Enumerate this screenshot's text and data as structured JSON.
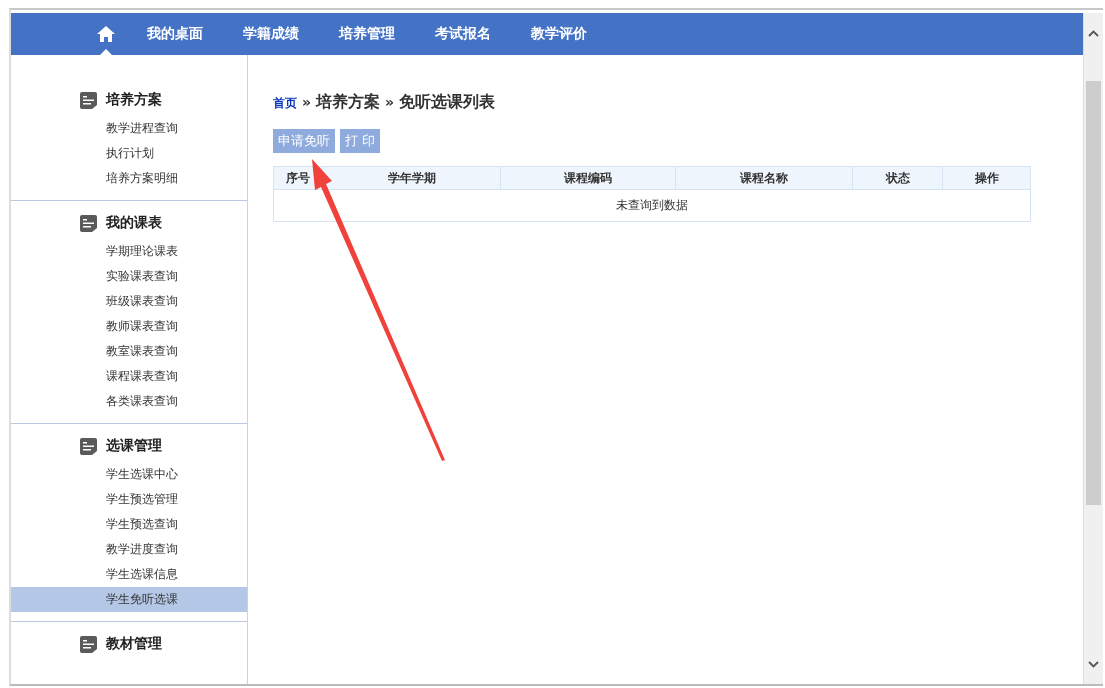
{
  "nav": {
    "items": [
      {
        "kind": "home",
        "selected": true
      },
      {
        "kind": "text",
        "label": "我的桌面",
        "selected": false
      },
      {
        "kind": "text",
        "label": "学籍成绩",
        "selected": false
      },
      {
        "kind": "text",
        "label": "培养管理",
        "selected": false
      },
      {
        "kind": "text",
        "label": "考试报名",
        "selected": false
      },
      {
        "kind": "text",
        "label": "教学评价",
        "selected": false
      }
    ]
  },
  "sidebar": {
    "groups": [
      {
        "title": "培养方案",
        "items": [
          {
            "label": "教学进程查询",
            "selected": false
          },
          {
            "label": "执行计划",
            "selected": false
          },
          {
            "label": "培养方案明细",
            "selected": false
          }
        ]
      },
      {
        "title": "我的课表",
        "items": [
          {
            "label": "学期理论课表",
            "selected": false
          },
          {
            "label": "实验课表查询",
            "selected": false
          },
          {
            "label": "班级课表查询",
            "selected": false
          },
          {
            "label": "教师课表查询",
            "selected": false
          },
          {
            "label": "教室课表查询",
            "selected": false
          },
          {
            "label": "课程课表查询",
            "selected": false
          },
          {
            "label": "各类课表查询",
            "selected": false
          }
        ]
      },
      {
        "title": "选课管理",
        "items": [
          {
            "label": "学生选课中心",
            "selected": false
          },
          {
            "label": "学生预选管理",
            "selected": false
          },
          {
            "label": "学生预选查询",
            "selected": false
          },
          {
            "label": "教学进度查询",
            "selected": false
          },
          {
            "label": "学生选课信息",
            "selected": false
          },
          {
            "label": "学生免听选课",
            "selected": true
          }
        ]
      },
      {
        "title": "教材管理"
      }
    ]
  },
  "breadcrumb": [
    {
      "kind": "link",
      "text": "首页"
    },
    {
      "kind": "sep",
      "text": "»"
    },
    {
      "kind": "crumb",
      "text": "培养方案"
    },
    {
      "kind": "sep",
      "text": "»"
    },
    {
      "kind": "crumb",
      "text": "免听选课列表"
    }
  ],
  "buttons": [
    "申请免听",
    "打 印"
  ],
  "table": {
    "columns": [
      "序号",
      "学年学期",
      "课程编码",
      "课程名称",
      "状态",
      "操作"
    ],
    "empty_text": "未查询到数据"
  }
}
